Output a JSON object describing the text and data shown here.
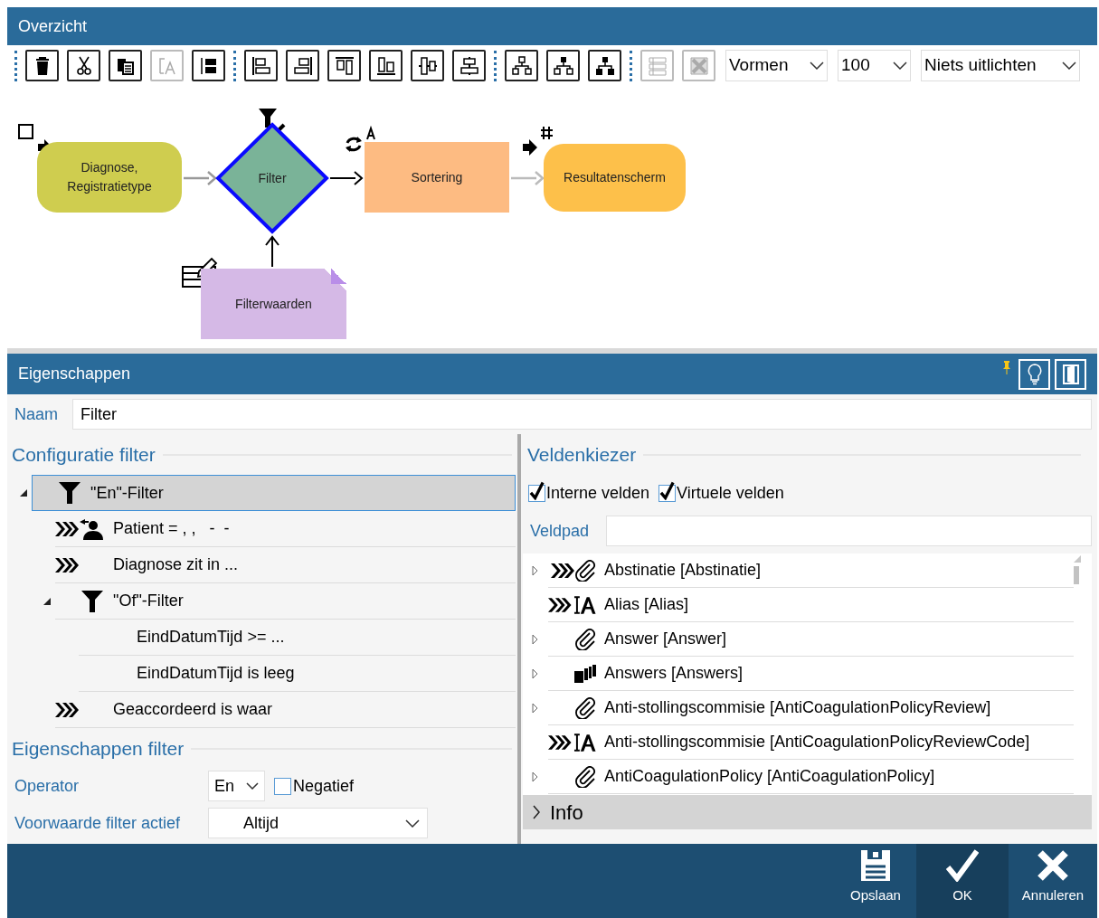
{
  "overview": {
    "title": "Overzicht",
    "toolbar": {
      "groups": [
        [
          {
            "kind": "trash",
            "disabled": false
          },
          {
            "kind": "scissors",
            "disabled": false
          },
          {
            "kind": "clipboard",
            "disabled": false
          },
          {
            "kind": "text-frame",
            "disabled": true
          },
          {
            "kind": "panel",
            "disabled": false
          }
        ],
        [
          {
            "kind": "align-left",
            "disabled": false
          },
          {
            "kind": "align-right",
            "disabled": false
          },
          {
            "kind": "align-top",
            "disabled": false
          },
          {
            "kind": "align-bottom",
            "disabled": false
          },
          {
            "kind": "align-middle",
            "disabled": false
          },
          {
            "kind": "align-center",
            "disabled": false
          }
        ],
        [
          {
            "kind": "tree-outline",
            "disabled": false
          },
          {
            "kind": "tree-mixed",
            "disabled": false
          },
          {
            "kind": "tree-filled",
            "disabled": false
          }
        ],
        [
          {
            "kind": "list",
            "disabled": true
          },
          {
            "kind": "grid-cross",
            "disabled": true
          }
        ]
      ],
      "dropdowns": [
        {
          "value": "Vormen"
        },
        {
          "value": "100"
        },
        {
          "value": "Niets uitlichten"
        }
      ]
    },
    "diagram": {
      "nodes": [
        {
          "label": "Diagnose, Registratietype",
          "kind": "rounded",
          "color": "#cfcd4f",
          "selected": false
        },
        {
          "label": "Filter",
          "kind": "diamond",
          "color": "#7ab398",
          "selected": true
        },
        {
          "label": "Sortering",
          "kind": "rect",
          "color": "#fdbb82",
          "selected": false
        },
        {
          "label": "Resultatenscherm",
          "kind": "rounded",
          "color": "#fdc04a",
          "selected": false
        },
        {
          "label": "Filterwaarden",
          "kind": "note",
          "color": "#d5b9e6",
          "selected": false
        }
      ]
    }
  },
  "properties": {
    "title": "Eigenschappen",
    "name_field": {
      "label": "Naam",
      "value": "Filter"
    },
    "config": {
      "title": "Configuratie filter",
      "tree": [
        {
          "label": "\"En\"-Filter",
          "kind": "group",
          "virtual": false,
          "expanded": true,
          "selected": true,
          "children": [
            {
              "label": "Patient = , ,   -  -",
              "kind": "person",
              "virtual": true,
              "selected": false
            },
            {
              "label": "Diagnose zit in ...",
              "kind": "condition",
              "virtual": true,
              "selected": false
            },
            {
              "label": "\"Of\"-Filter",
              "kind": "group",
              "virtual": false,
              "expanded": true,
              "selected": false,
              "children": [
                {
                  "label": "EindDatumTijd >= ...",
                  "kind": "condition",
                  "virtual": false,
                  "selected": false
                },
                {
                  "label": "EindDatumTijd is leeg",
                  "kind": "condition",
                  "virtual": false,
                  "selected": false
                }
              ]
            },
            {
              "label": "Geaccordeerd is waar",
              "kind": "condition",
              "virtual": true,
              "selected": false
            }
          ]
        }
      ]
    },
    "filter_props": {
      "title": "Eigenschappen filter",
      "operator": {
        "label": "Operator",
        "value": "En"
      },
      "negate": {
        "label": "Negatief",
        "checked": false
      },
      "condition": {
        "label": "Voorwaarde filter actief",
        "value": "Altijd"
      }
    },
    "field_picker": {
      "title": "Veldenkiezer",
      "checkboxes": [
        {
          "label": "Interne velden",
          "checked": true
        },
        {
          "label": "Virtuele velden",
          "checked": true
        }
      ],
      "path": {
        "label": "Veldpad"
      },
      "fields": [
        {
          "label": "Abstinatie [Abstinatie]",
          "kind": "link",
          "virtual": true,
          "expandable": true
        },
        {
          "label": "Alias [Alias]",
          "kind": "text",
          "virtual": true,
          "expandable": false
        },
        {
          "label": "Answer [Answer]",
          "kind": "link",
          "virtual": false,
          "expandable": true
        },
        {
          "label": "Answers [Answers]",
          "kind": "list",
          "virtual": false,
          "expandable": true
        },
        {
          "label": "Anti-stollingscommisie [AntiCoagulationPolicyReview]",
          "kind": "link",
          "virtual": false,
          "expandable": true
        },
        {
          "label": "Anti-stollingscommisie [AntiCoagulationPolicyReviewCode]",
          "kind": "text",
          "virtual": true,
          "expandable": false
        },
        {
          "label": "AntiCoagulationPolicy [AntiCoagulationPolicy]",
          "kind": "link",
          "virtual": false,
          "expandable": true
        }
      ],
      "info": {
        "label": "Info",
        "expanded": false
      }
    }
  },
  "footer": {
    "buttons": [
      {
        "label": "Opslaan",
        "kind": "save",
        "highlighted": false
      },
      {
        "label": "OK",
        "kind": "ok",
        "highlighted": true
      },
      {
        "label": "Annuleren",
        "kind": "cancel",
        "highlighted": false
      }
    ]
  }
}
